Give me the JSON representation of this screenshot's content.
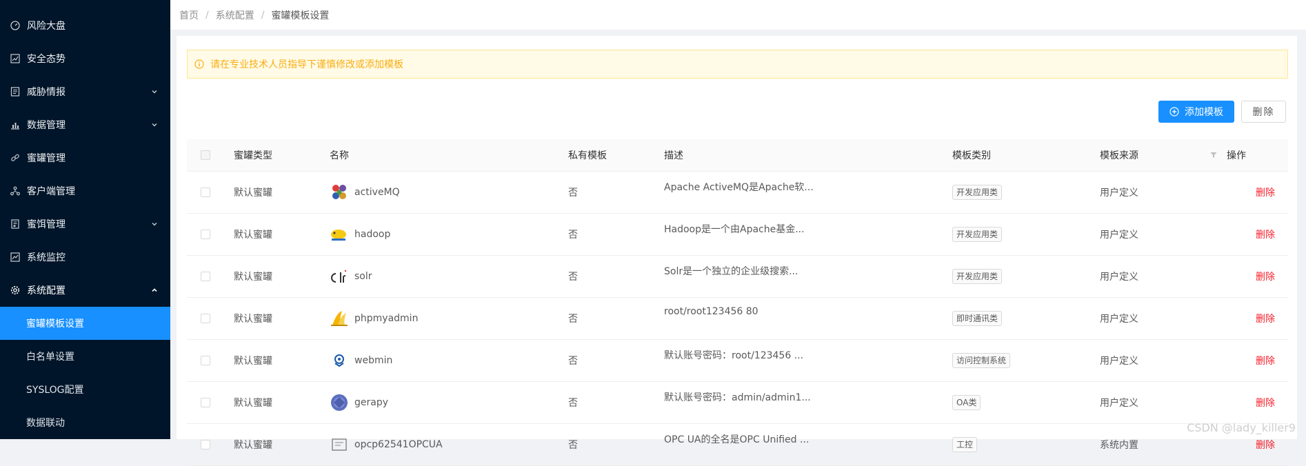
{
  "sidebar": {
    "items": [
      {
        "label": "风险大盘",
        "icon": "dashboard-icon"
      },
      {
        "label": "安全态势",
        "icon": "line-chart-icon"
      },
      {
        "label": "威胁情报",
        "icon": "profile-icon",
        "expandable": true
      },
      {
        "label": "数据管理",
        "icon": "bar-chart-icon",
        "expandable": true
      },
      {
        "label": "蜜罐管理",
        "icon": "link-icon"
      },
      {
        "label": "客户端管理",
        "icon": "cluster-icon"
      },
      {
        "label": "蜜饵管理",
        "icon": "file-icon",
        "expandable": true
      },
      {
        "label": "系统监控",
        "icon": "monitor-chart-icon"
      },
      {
        "label": "系统配置",
        "icon": "setting-icon",
        "expanded": true
      }
    ],
    "sub_items": [
      {
        "label": "蜜罐模板设置",
        "active": true
      },
      {
        "label": "白名单设置"
      },
      {
        "label": "SYSLOG配置"
      },
      {
        "label": "数据联动"
      }
    ]
  },
  "breadcrumb": [
    "首页",
    "系统配置",
    "蜜罐模板设置"
  ],
  "alert": {
    "text": "请在专业技术人员指导下谨慎修改或添加模板",
    "color": "#faad14"
  },
  "toolbar": {
    "add_label": "添加模板",
    "delete_label": "删除"
  },
  "table": {
    "headers": {
      "type": "蜜罐类型",
      "name": "名称",
      "private": "私有模板",
      "desc": "描述",
      "category": "模板类别",
      "source": "模板来源",
      "op": "操作"
    },
    "rows": [
      {
        "type": "默认蜜罐",
        "name": "activeMQ",
        "logo": "activemq-logo",
        "private": "否",
        "desc": "Apache ActiveMQ是Apache软...",
        "category": "开发应用类",
        "source": "用户定义",
        "op": "删除"
      },
      {
        "type": "默认蜜罐",
        "name": "hadoop",
        "logo": "hadoop-logo",
        "private": "否",
        "desc": "Hadoop是一个由Apache基金...",
        "category": "开发应用类",
        "source": "用户定义",
        "op": "删除"
      },
      {
        "type": "默认蜜罐",
        "name": "solr",
        "logo": "solr-logo",
        "private": "否",
        "desc": "Solr是一个独立的企业级搜索...",
        "category": "开发应用类",
        "source": "用户定义",
        "op": "删除"
      },
      {
        "type": "默认蜜罐",
        "name": "phpmyadmin",
        "logo": "phpmyadmin-logo",
        "private": "否",
        "desc": "root/root123456 80",
        "category": "即时通讯类",
        "source": "用户定义",
        "op": "删除"
      },
      {
        "type": "默认蜜罐",
        "name": "webmin",
        "logo": "webmin-logo",
        "private": "否",
        "desc": "默认账号密码：root/123456 ...",
        "category": "访问控制系统",
        "source": "用户定义",
        "op": "删除"
      },
      {
        "type": "默认蜜罐",
        "name": "gerapy",
        "logo": "gerapy-logo",
        "private": "否",
        "desc": "默认账号密码：admin/admin1...",
        "category": "OA类",
        "source": "用户定义",
        "op": "删除"
      },
      {
        "type": "默认蜜罐",
        "name": "opcp62541OPCUA",
        "logo": "opcua-logo",
        "private": "否",
        "desc": "OPC UA的全名是OPC Unified ...",
        "category": "工控",
        "source": "系统内置",
        "op": "删除"
      }
    ]
  },
  "watermark": "CSDN @lady_killer9",
  "colors": {
    "sidebar_bg": "#001529",
    "primary": "#1890ff",
    "danger": "#f5222d"
  }
}
